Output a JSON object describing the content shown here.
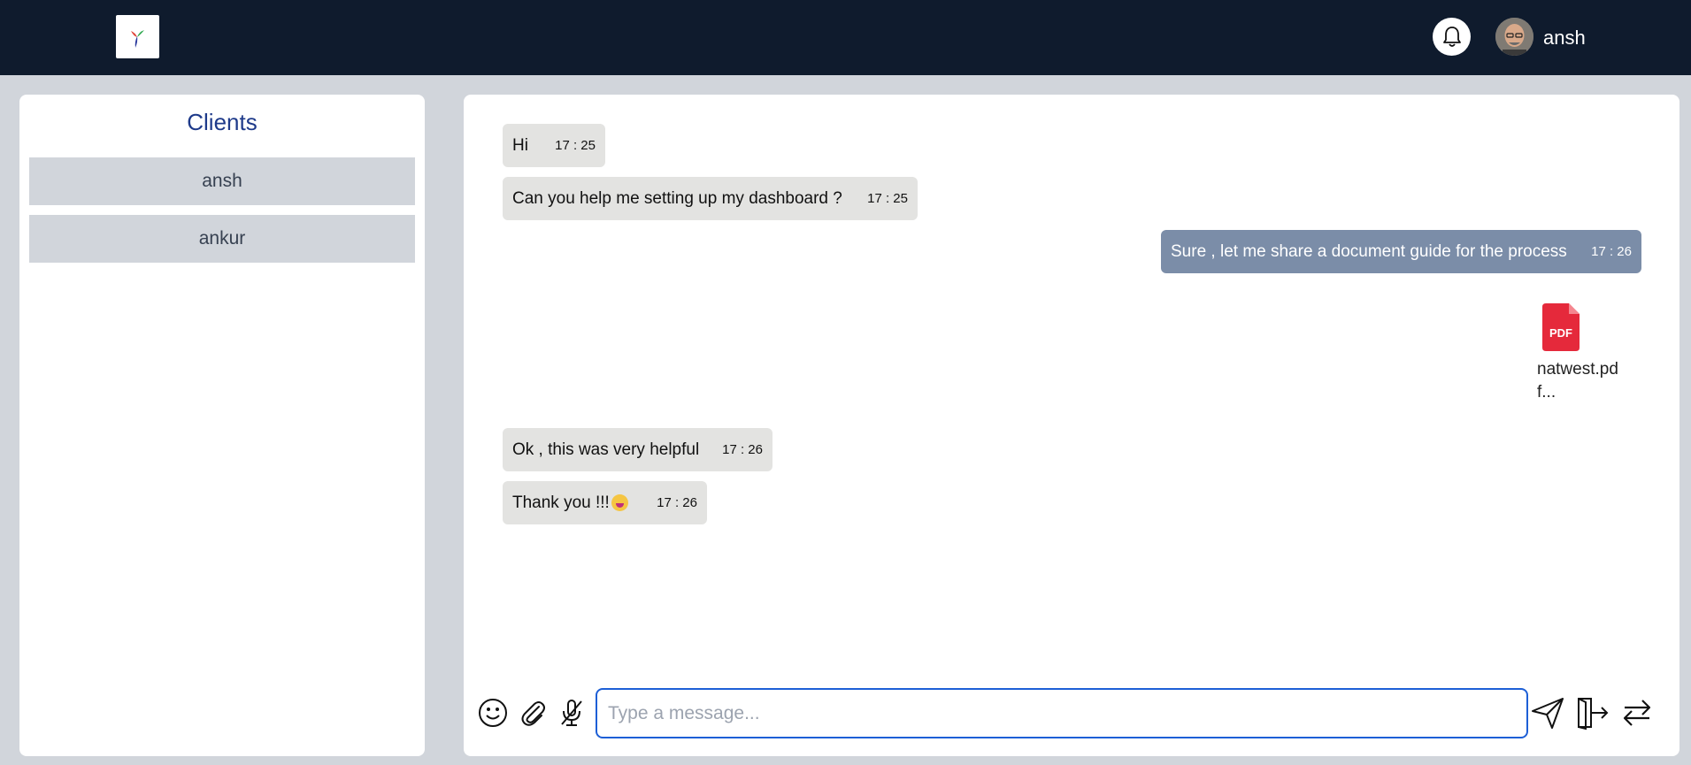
{
  "header": {
    "username": "ansh"
  },
  "sidebar": {
    "title": "Clients",
    "clients": [
      "ansh",
      "ankur"
    ]
  },
  "messages": [
    {
      "text": "Hi",
      "time": "17 : 25",
      "direction": "in"
    },
    {
      "text": "Can you help me setting up my dashboard ?",
      "time": "17 : 25",
      "direction": "in"
    },
    {
      "text": "Sure , let me share a document guide for the process",
      "time": "17 : 26",
      "direction": "out"
    },
    {
      "text": "Ok , this was very helpful",
      "time": "17 : 26",
      "direction": "in"
    },
    {
      "text": "Thank you !!!",
      "time": "17 : 26",
      "direction": "in"
    }
  ],
  "attachment": {
    "icon_label": "PDF",
    "filename": "natwest.pdf...",
    "icon": "pdf-file-icon"
  },
  "composer": {
    "placeholder": "Type a message...",
    "icons": [
      "emoji-icon",
      "paperclip-icon",
      "microphone-icon",
      "send-icon",
      "exit-icon",
      "swap-icon"
    ]
  },
  "colors": {
    "header_bg": "#0f1b2d",
    "accent": "#1e3a8a",
    "incoming_bubble": "#e3e3e1",
    "outgoing_bubble": "#7b8da8",
    "input_border": "#1d5fd6",
    "pdf_red": "#e5293b"
  }
}
